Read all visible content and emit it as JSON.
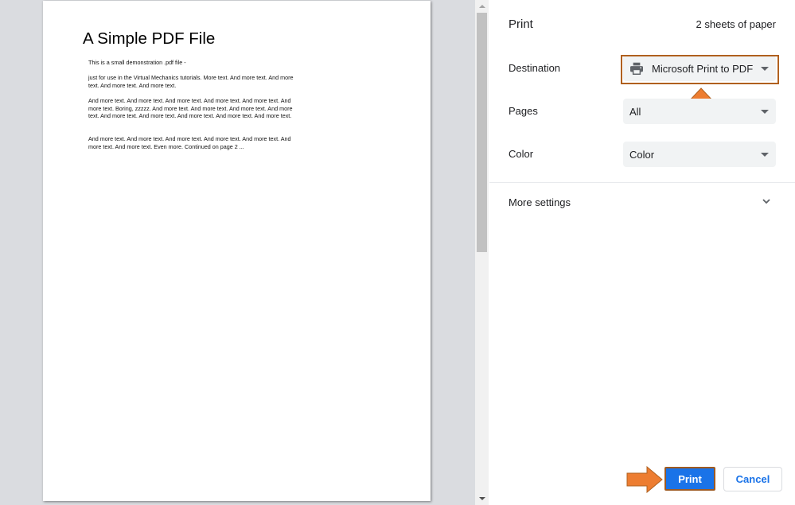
{
  "preview": {
    "document": {
      "title": "A Simple PDF File",
      "paragraphs": [
        "This is a small demonstration .pdf file -",
        "just for use in the Virtual Mechanics tutorials. More text. And more text. And more text. And more text. And more text.",
        "And more text. And more text. And more text. And more text. And more text. And more text. Boring, zzzzz. And more text. And more text. And more text. And more text. And more text. And more text. And more text. And more text. And more text.",
        "And more text. And more text. And more text. And more text. And more text. And more text. And more text. Even more. Continued on page 2 ..."
      ]
    }
  },
  "sidebar": {
    "title": "Print",
    "sheet_count": "2 sheets of paper",
    "destination": {
      "label": "Destination",
      "value": "Microsoft Print to PDF",
      "icon": "printer-icon"
    },
    "pages": {
      "label": "Pages",
      "value": "All"
    },
    "color": {
      "label": "Color",
      "value": "Color"
    },
    "more_settings": {
      "label": "More settings",
      "icon": "chevron-down-icon"
    },
    "buttons": {
      "print": "Print",
      "cancel": "Cancel"
    }
  },
  "colors": {
    "accent": "#1a73e8",
    "annotation_arrow": "#ed7d31",
    "annotation_border": "#b0601e"
  }
}
